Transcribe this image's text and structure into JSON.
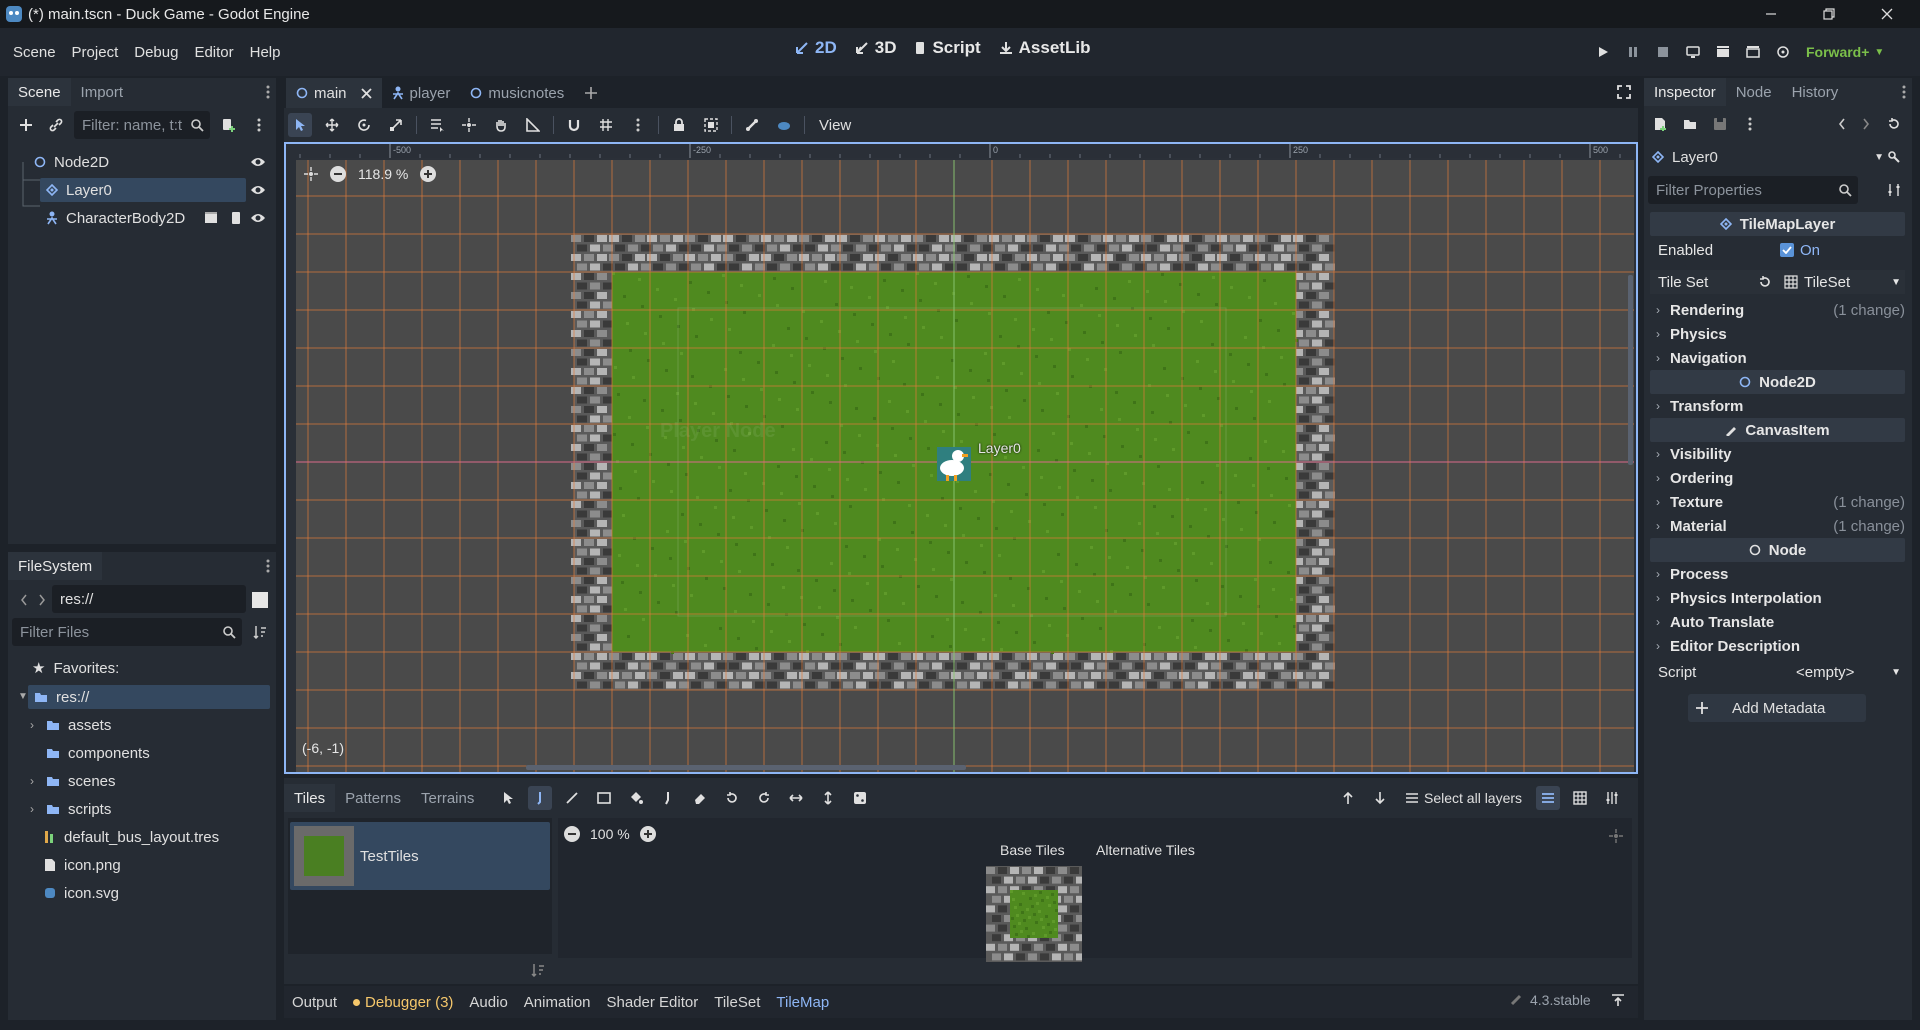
{
  "window": {
    "title": "(*) main.tscn - Duck Game - Godot Engine"
  },
  "menu": [
    "Scene",
    "Project",
    "Debug",
    "Editor",
    "Help"
  ],
  "main_screens": [
    {
      "label": "2D",
      "icon": "2d-icon",
      "active": true
    },
    {
      "label": "3D",
      "icon": "3d-icon",
      "active": false
    },
    {
      "label": "Script",
      "icon": "script-icon",
      "active": false
    },
    {
      "label": "AssetLib",
      "icon": "assetlib-icon",
      "active": false
    }
  ],
  "renderer": "Forward+",
  "scene_dock": {
    "tabs": [
      "Scene",
      "Import"
    ],
    "filter_placeholder": "Filter: name, t:t",
    "nodes": [
      {
        "label": "Node2D",
        "icon": "node2d-icon"
      },
      {
        "label": "Layer0",
        "icon": "tilemaplayer-icon",
        "selected": true
      },
      {
        "label": "CharacterBody2D",
        "icon": "characterbody2d-icon"
      }
    ]
  },
  "filesystem_dock": {
    "tab": "FileSystem",
    "path": "res://",
    "filter_placeholder": "Filter Files",
    "favorites": "Favorites:",
    "items": [
      {
        "label": "res://",
        "type": "folder",
        "selected": true
      },
      {
        "label": "assets",
        "type": "folder"
      },
      {
        "label": "components",
        "type": "folder"
      },
      {
        "label": "scenes",
        "type": "folder"
      },
      {
        "label": "scripts",
        "type": "folder"
      },
      {
        "label": "default_bus_layout.tres",
        "type": "resource"
      },
      {
        "label": "icon.png",
        "type": "image"
      },
      {
        "label": "icon.svg",
        "type": "svg"
      }
    ]
  },
  "scene_tabs": [
    {
      "label": "main",
      "icon": "node2d-icon",
      "active": true
    },
    {
      "label": "player",
      "icon": "characterbody2d-icon"
    },
    {
      "label": "musicnotes",
      "icon": "node2d-icon"
    }
  ],
  "viewport": {
    "view_menu": "View",
    "zoom": "118.9 %",
    "ruler_labels": [
      "-500",
      "-250",
      "0",
      "250",
      "500"
    ],
    "node_label": "Layer0",
    "faded_label": "Player Node",
    "cursor_coords": "(-6, -1)"
  },
  "tilemap_panel": {
    "tabs": [
      "Tiles",
      "Patterns",
      "Terrains"
    ],
    "select_layers": "Select all layers",
    "tileset_name": "TestTiles",
    "zoom": "100 %",
    "subtabs": [
      "Base Tiles",
      "Alternative Tiles"
    ]
  },
  "bottom_tabs": [
    "Output",
    "Debugger (3)",
    "Audio",
    "Animation",
    "Shader Editor",
    "TileSet",
    "TileMap"
  ],
  "version": "4.3.stable",
  "inspector": {
    "tabs": [
      "Inspector",
      "Node",
      "History"
    ],
    "object": "Layer0",
    "filter_placeholder": "Filter Properties",
    "class_header": "TileMapLayer",
    "enabled_label": "Enabled",
    "enabled_value": "On",
    "tileset_label": "Tile Set",
    "tileset_value": "TileSet",
    "tilemap_sections": [
      {
        "label": "Rendering",
        "change": "(1 change)"
      },
      {
        "label": "Physics",
        "change": ""
      },
      {
        "label": "Navigation",
        "change": ""
      }
    ],
    "node2d_header": "Node2D",
    "node2d_sections": [
      {
        "label": "Transform",
        "change": ""
      }
    ],
    "canvas_header": "CanvasItem",
    "canvas_sections": [
      {
        "label": "Visibility",
        "change": ""
      },
      {
        "label": "Ordering",
        "change": ""
      },
      {
        "label": "Texture",
        "change": "(1 change)"
      },
      {
        "label": "Material",
        "change": "(1 change)"
      }
    ],
    "node_header": "Node",
    "node_sections": [
      {
        "label": "Process",
        "change": ""
      },
      {
        "label": "Physics Interpolation",
        "change": ""
      },
      {
        "label": "Auto Translate",
        "change": ""
      },
      {
        "label": "Editor Description",
        "change": ""
      }
    ],
    "script_label": "Script",
    "script_value": "<empty>",
    "add_metadata": "Add Metadata"
  },
  "colors": {
    "accent": "#8eb6f5",
    "grid": "#e07a3a",
    "grass": "#4f8a1f",
    "bg": "#21262e"
  }
}
